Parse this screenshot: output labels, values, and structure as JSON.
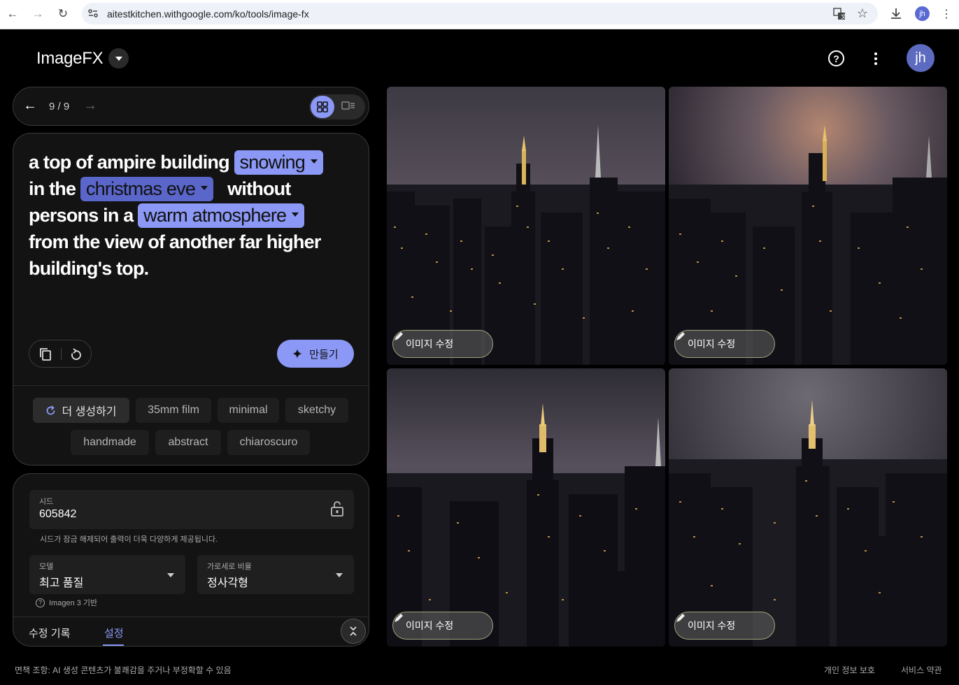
{
  "browser": {
    "url": "aitestkitchen.withgoogle.com/ko/tools/image-fx",
    "profile_initials": "jh"
  },
  "app": {
    "title": "ImageFX",
    "avatar_initials": "jh"
  },
  "pager": {
    "count": "9 / 9"
  },
  "prompt": {
    "parts": [
      {
        "text": "a top of ampire building "
      },
      {
        "chip": "snowing"
      },
      {
        "text": " in the "
      },
      {
        "chip": "christmas eve"
      },
      {
        "text": " without persons in a "
      },
      {
        "chip": "warm atmosphere"
      },
      {
        "text": " from the view of another far higher building's top."
      }
    ],
    "t1": "a top of ampire building",
    "chip1": "snowing",
    "t2": "in the",
    "chip2": "christmas eve",
    "t3": "without",
    "t4": "persons in a",
    "chip3": "warm atmosphere",
    "t5": "from the view of another far higher",
    "t6": "building's top."
  },
  "actions": {
    "make_label": "만들기"
  },
  "tags": {
    "more_label": "더 생성하기",
    "items": [
      "35mm film",
      "minimal",
      "sketchy",
      "handmade",
      "abstract",
      "chiaroscuro"
    ]
  },
  "settings": {
    "seed_label": "시드",
    "seed_value": "605842",
    "seed_note": "시드가 잠금 해제되어 출력이 더욱 다양하게 제공됩니다.",
    "model_label": "모델",
    "model_value": "최고 품질",
    "ratio_label": "가로세로 비율",
    "ratio_value": "정사각형",
    "imagen_note": "Imagen 3 기반",
    "tab_history": "수정 기록",
    "tab_settings": "설정"
  },
  "images": {
    "edit_label": "이미지 수정"
  },
  "footer": {
    "disclaimer": "면책 조항: AI 생성 콘텐츠가 불쾌감을 주거나 부정확할 수 있음",
    "privacy": "개인 정보 보호",
    "terms": "서비스 약관"
  },
  "colors": {
    "accent": "#8b98f5",
    "background": "#000000",
    "panel": "#131313"
  }
}
